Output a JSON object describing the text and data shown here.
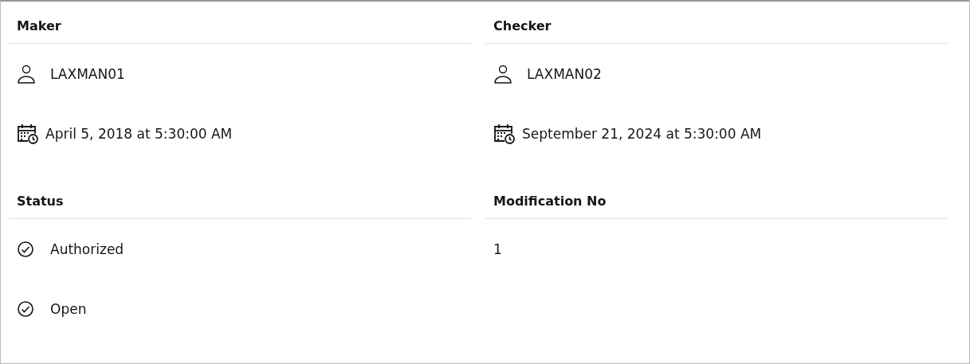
{
  "sections": [
    {
      "title": "Maker",
      "items": [
        {
          "kind": "user",
          "text": "LAXMAN01"
        },
        {
          "kind": "datetime",
          "text": "April 5, 2018 at 5:30:00 AM"
        }
      ]
    },
    {
      "title": "Checker",
      "items": [
        {
          "kind": "user",
          "text": "LAXMAN02"
        },
        {
          "kind": "datetime",
          "text": "September 21, 2024 at 5:30:00 AM"
        }
      ]
    },
    {
      "title": "Status",
      "items": [
        {
          "kind": "status",
          "text": "Authorized"
        },
        {
          "kind": "status",
          "text": "Open"
        }
      ]
    },
    {
      "title": "Modification No",
      "items": [
        {
          "kind": "plain",
          "text": "1"
        }
      ]
    }
  ]
}
